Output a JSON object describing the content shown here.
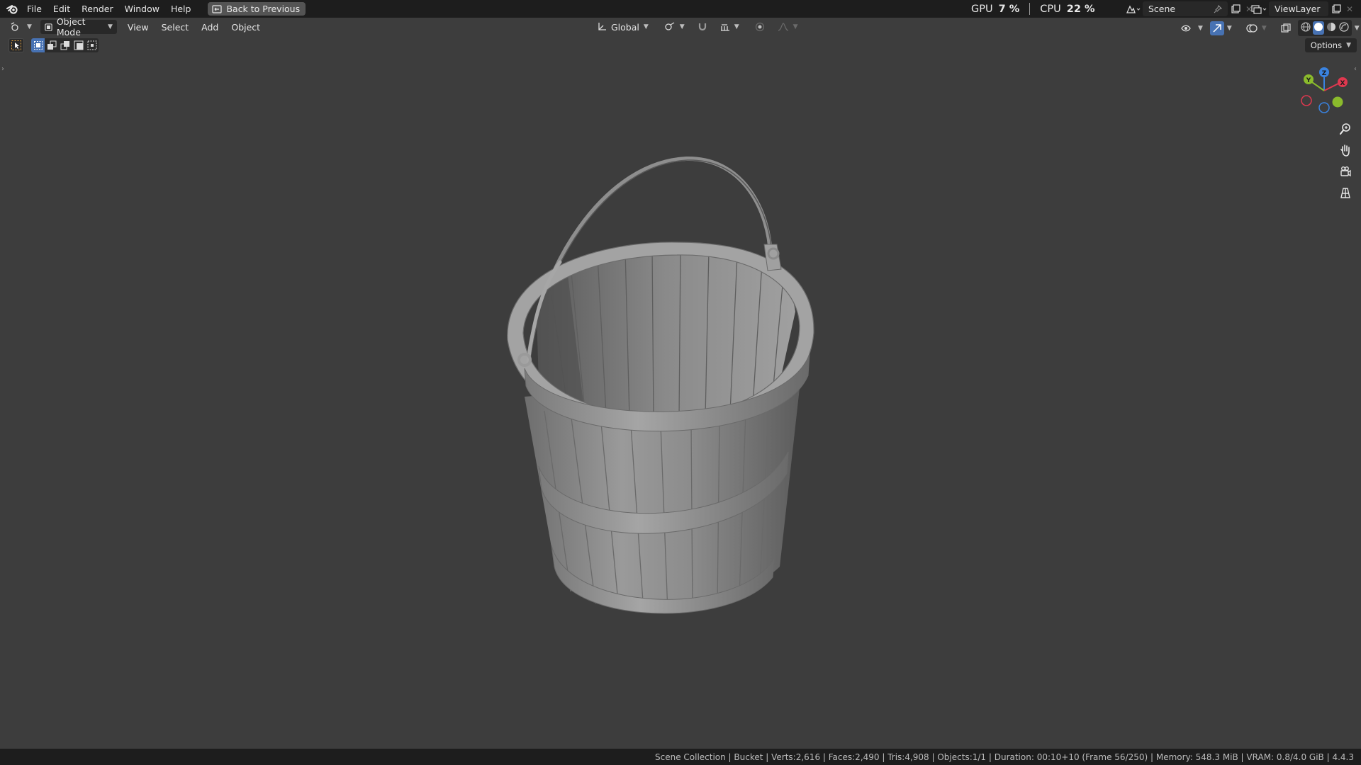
{
  "topbar": {
    "menus": [
      "File",
      "Edit",
      "Render",
      "Window",
      "Help"
    ],
    "back_button": "Back to Previous",
    "gpu_label": "GPU",
    "gpu_value": "7 %",
    "cpu_label": "CPU",
    "cpu_value": "22 %",
    "scene_name": "Scene",
    "view_layer_name": "ViewLayer"
  },
  "viewport_header": {
    "mode": "Object Mode",
    "menus": [
      "View",
      "Select",
      "Add",
      "Object"
    ],
    "transform_orientation": "Global"
  },
  "viewport": {
    "options_label": "Options",
    "gizmo_axes": {
      "x": "X",
      "y": "Y",
      "z": "Z"
    },
    "object_name": "Bucket"
  },
  "statusbar": {
    "text": "Scene Collection | Bucket | Verts:2,616 | Faces:2,490 | Tris:4,908 | Objects:1/1 | Duration: 00:10+10 (Frame 56/250) | Memory: 548.3 MiB | VRAM: 0.8/4.0 GiB | 4.4.3"
  },
  "colors": {
    "topbar_bg": "#1d1d1d",
    "viewport_bg": "#3d3d3d",
    "accent_blue": "#4772b3",
    "axis_x": "#e0384f",
    "axis_y": "#8bbb2c",
    "axis_z": "#3a83e0"
  }
}
